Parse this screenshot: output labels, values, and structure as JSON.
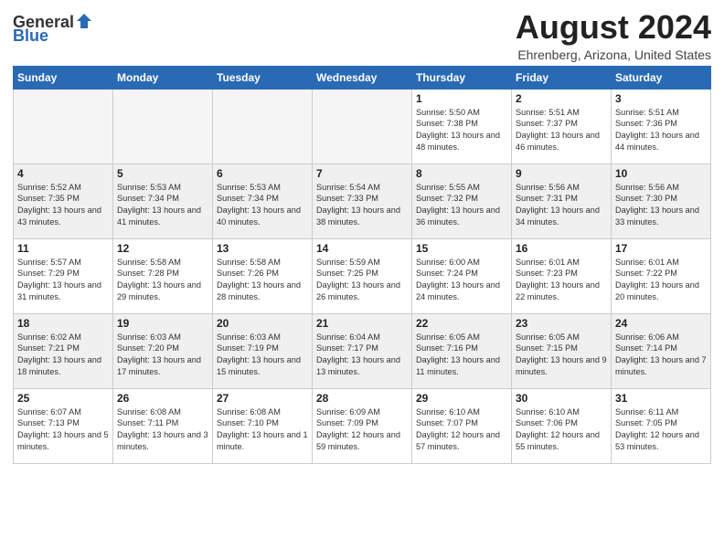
{
  "header": {
    "logo_general": "General",
    "logo_blue": "Blue",
    "month_title": "August 2024",
    "location": "Ehrenberg, Arizona, United States"
  },
  "days_of_week": [
    "Sunday",
    "Monday",
    "Tuesday",
    "Wednesday",
    "Thursday",
    "Friday",
    "Saturday"
  ],
  "weeks": [
    [
      {
        "day": "",
        "empty": true
      },
      {
        "day": "",
        "empty": true
      },
      {
        "day": "",
        "empty": true
      },
      {
        "day": "",
        "empty": true
      },
      {
        "day": "1",
        "sunrise": "5:50 AM",
        "sunset": "7:38 PM",
        "daylight": "13 hours and 48 minutes."
      },
      {
        "day": "2",
        "sunrise": "5:51 AM",
        "sunset": "7:37 PM",
        "daylight": "13 hours and 46 minutes."
      },
      {
        "day": "3",
        "sunrise": "5:51 AM",
        "sunset": "7:36 PM",
        "daylight": "13 hours and 44 minutes."
      }
    ],
    [
      {
        "day": "4",
        "sunrise": "5:52 AM",
        "sunset": "7:35 PM",
        "daylight": "13 hours and 43 minutes."
      },
      {
        "day": "5",
        "sunrise": "5:53 AM",
        "sunset": "7:34 PM",
        "daylight": "13 hours and 41 minutes."
      },
      {
        "day": "6",
        "sunrise": "5:53 AM",
        "sunset": "7:34 PM",
        "daylight": "13 hours and 40 minutes."
      },
      {
        "day": "7",
        "sunrise": "5:54 AM",
        "sunset": "7:33 PM",
        "daylight": "13 hours and 38 minutes."
      },
      {
        "day": "8",
        "sunrise": "5:55 AM",
        "sunset": "7:32 PM",
        "daylight": "13 hours and 36 minutes."
      },
      {
        "day": "9",
        "sunrise": "5:56 AM",
        "sunset": "7:31 PM",
        "daylight": "13 hours and 34 minutes."
      },
      {
        "day": "10",
        "sunrise": "5:56 AM",
        "sunset": "7:30 PM",
        "daylight": "13 hours and 33 minutes."
      }
    ],
    [
      {
        "day": "11",
        "sunrise": "5:57 AM",
        "sunset": "7:29 PM",
        "daylight": "13 hours and 31 minutes."
      },
      {
        "day": "12",
        "sunrise": "5:58 AM",
        "sunset": "7:28 PM",
        "daylight": "13 hours and 29 minutes."
      },
      {
        "day": "13",
        "sunrise": "5:58 AM",
        "sunset": "7:26 PM",
        "daylight": "13 hours and 28 minutes."
      },
      {
        "day": "14",
        "sunrise": "5:59 AM",
        "sunset": "7:25 PM",
        "daylight": "13 hours and 26 minutes."
      },
      {
        "day": "15",
        "sunrise": "6:00 AM",
        "sunset": "7:24 PM",
        "daylight": "13 hours and 24 minutes."
      },
      {
        "day": "16",
        "sunrise": "6:01 AM",
        "sunset": "7:23 PM",
        "daylight": "13 hours and 22 minutes."
      },
      {
        "day": "17",
        "sunrise": "6:01 AM",
        "sunset": "7:22 PM",
        "daylight": "13 hours and 20 minutes."
      }
    ],
    [
      {
        "day": "18",
        "sunrise": "6:02 AM",
        "sunset": "7:21 PM",
        "daylight": "13 hours and 18 minutes."
      },
      {
        "day": "19",
        "sunrise": "6:03 AM",
        "sunset": "7:20 PM",
        "daylight": "13 hours and 17 minutes."
      },
      {
        "day": "20",
        "sunrise": "6:03 AM",
        "sunset": "7:19 PM",
        "daylight": "13 hours and 15 minutes."
      },
      {
        "day": "21",
        "sunrise": "6:04 AM",
        "sunset": "7:17 PM",
        "daylight": "13 hours and 13 minutes."
      },
      {
        "day": "22",
        "sunrise": "6:05 AM",
        "sunset": "7:16 PM",
        "daylight": "13 hours and 11 minutes."
      },
      {
        "day": "23",
        "sunrise": "6:05 AM",
        "sunset": "7:15 PM",
        "daylight": "13 hours and 9 minutes."
      },
      {
        "day": "24",
        "sunrise": "6:06 AM",
        "sunset": "7:14 PM",
        "daylight": "13 hours and 7 minutes."
      }
    ],
    [
      {
        "day": "25",
        "sunrise": "6:07 AM",
        "sunset": "7:13 PM",
        "daylight": "13 hours and 5 minutes."
      },
      {
        "day": "26",
        "sunrise": "6:08 AM",
        "sunset": "7:11 PM",
        "daylight": "13 hours and 3 minutes."
      },
      {
        "day": "27",
        "sunrise": "6:08 AM",
        "sunset": "7:10 PM",
        "daylight": "13 hours and 1 minute."
      },
      {
        "day": "28",
        "sunrise": "6:09 AM",
        "sunset": "7:09 PM",
        "daylight": "12 hours and 59 minutes."
      },
      {
        "day": "29",
        "sunrise": "6:10 AM",
        "sunset": "7:07 PM",
        "daylight": "12 hours and 57 minutes."
      },
      {
        "day": "30",
        "sunrise": "6:10 AM",
        "sunset": "7:06 PM",
        "daylight": "12 hours and 55 minutes."
      },
      {
        "day": "31",
        "sunrise": "6:11 AM",
        "sunset": "7:05 PM",
        "daylight": "12 hours and 53 minutes."
      }
    ]
  ],
  "labels": {
    "sunrise_label": "Sunrise:",
    "sunset_label": "Sunset:",
    "daylight_label": "Daylight:"
  }
}
